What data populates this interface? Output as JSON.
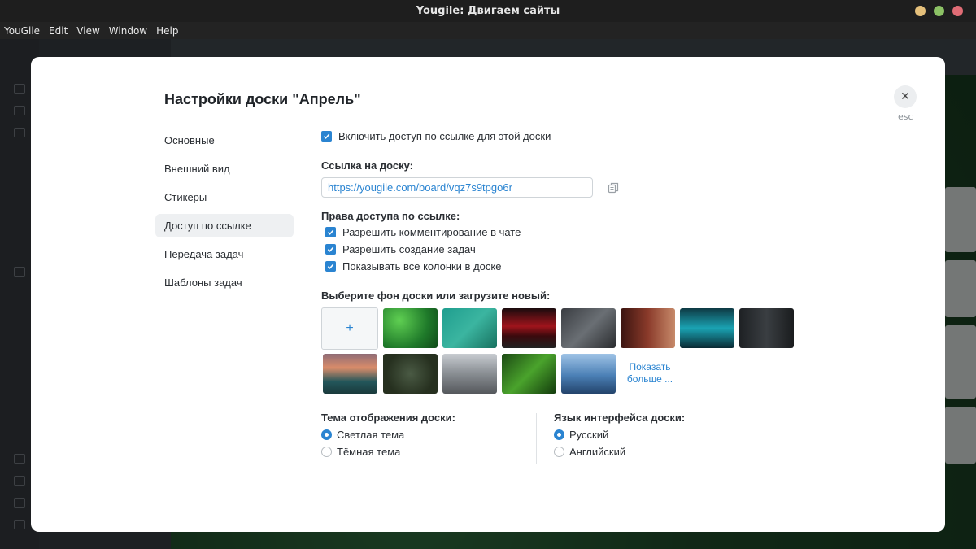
{
  "window": {
    "title": "Yougile: Двигаем сайты",
    "controls": [
      {
        "name": "minimize",
        "color": "#e5c07b"
      },
      {
        "name": "maximize",
        "color": "#8cc265"
      },
      {
        "name": "close",
        "color": "#e06c75"
      }
    ]
  },
  "menubar": {
    "items": [
      "YouGile",
      "Edit",
      "View",
      "Window",
      "Help"
    ]
  },
  "modal": {
    "title": "Настройки доски \"Апрель\"",
    "esc_label": "esc",
    "nav": [
      {
        "label": "Основные",
        "active": false
      },
      {
        "label": "Внешний вид",
        "active": false
      },
      {
        "label": "Стикеры",
        "active": false
      },
      {
        "label": "Доступ по ссылке",
        "active": true
      },
      {
        "label": "Передача задач",
        "active": false
      },
      {
        "label": "Шаблоны задач",
        "active": false
      }
    ],
    "enable_link": {
      "label": "Включить доступ по ссылке для этой доски",
      "checked": true
    },
    "link_label": "Ссылка на доску:",
    "link_value": "https://yougile.com/board/vqz7s9tpgo6r",
    "rights_label": "Права доступа по ссылке:",
    "rights": [
      {
        "label": "Разрешить комментирование в чате",
        "checked": true
      },
      {
        "label": "Разрешить создание задач",
        "checked": true
      },
      {
        "label": "Показывать все колонки в доске",
        "checked": true
      }
    ],
    "background_label": "Выберите фон доски или загрузите новый:",
    "upload_symbol": "+",
    "show_more": "Показать больше ...",
    "theme_label": "Тема отображения доски:",
    "themes": [
      {
        "label": "Светлая тема",
        "selected": true
      },
      {
        "label": "Тёмная тема",
        "selected": false
      }
    ],
    "language_label": "Язык интерфейса доски:",
    "languages": [
      {
        "label": "Русский",
        "selected": true
      },
      {
        "label": "Английский",
        "selected": false
      }
    ],
    "accent_color": "#2a84d1"
  }
}
